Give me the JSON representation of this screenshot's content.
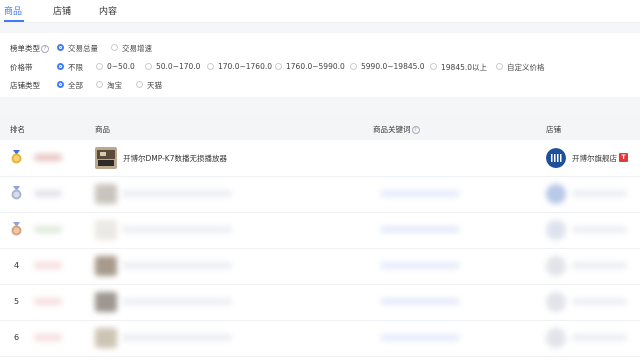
{
  "tabs": [
    {
      "label": "商品",
      "active": true
    },
    {
      "label": "店铺",
      "active": false
    },
    {
      "label": "内容",
      "active": false
    }
  ],
  "filters": {
    "ranking_type": {
      "label": "榜单类型",
      "options": [
        {
          "label": "交易总量",
          "selected": true
        },
        {
          "label": "交易增速",
          "selected": false
        }
      ]
    },
    "price_band": {
      "label": "价格带",
      "options": [
        {
          "label": "不限",
          "selected": true
        },
        {
          "label": "0~50.0",
          "selected": false
        },
        {
          "label": "50.0~170.0",
          "selected": false
        },
        {
          "label": "170.0~1760.0",
          "selected": false
        },
        {
          "label": "1760.0~5990.0",
          "selected": false
        },
        {
          "label": "5990.0~19845.0",
          "selected": false
        },
        {
          "label": "19845.0以上",
          "selected": false
        },
        {
          "label": "自定义价格",
          "selected": false
        }
      ]
    },
    "shop_type": {
      "label": "店铺类型",
      "options": [
        {
          "label": "全部",
          "selected": true
        },
        {
          "label": "淘宝",
          "selected": false
        },
        {
          "label": "天猫",
          "selected": false
        }
      ]
    }
  },
  "table": {
    "headers": {
      "rank": "排名",
      "product": "商品",
      "keywords": "商品关键词",
      "shop": "店铺"
    },
    "rows": [
      {
        "rank": "",
        "medal": "gold",
        "product": "开博尔DMP-K7数播无损播放器",
        "shop": "开博尔旗舰店",
        "shop_badge": "T"
      },
      {
        "rank": "",
        "medal": "silver",
        "product": "",
        "shop": ""
      },
      {
        "rank": "",
        "medal": "bronze",
        "product": "",
        "shop": ""
      },
      {
        "rank": "4",
        "product": "",
        "shop": ""
      },
      {
        "rank": "5",
        "product": "",
        "shop": ""
      },
      {
        "rank": "6",
        "product": "",
        "shop": ""
      }
    ]
  },
  "colors": {
    "accent": "#3d7cf5",
    "gold": "#e8b53c",
    "silver": "#a9b6cf",
    "bronze": "#d9a27c",
    "tmall": "#e4393c"
  }
}
